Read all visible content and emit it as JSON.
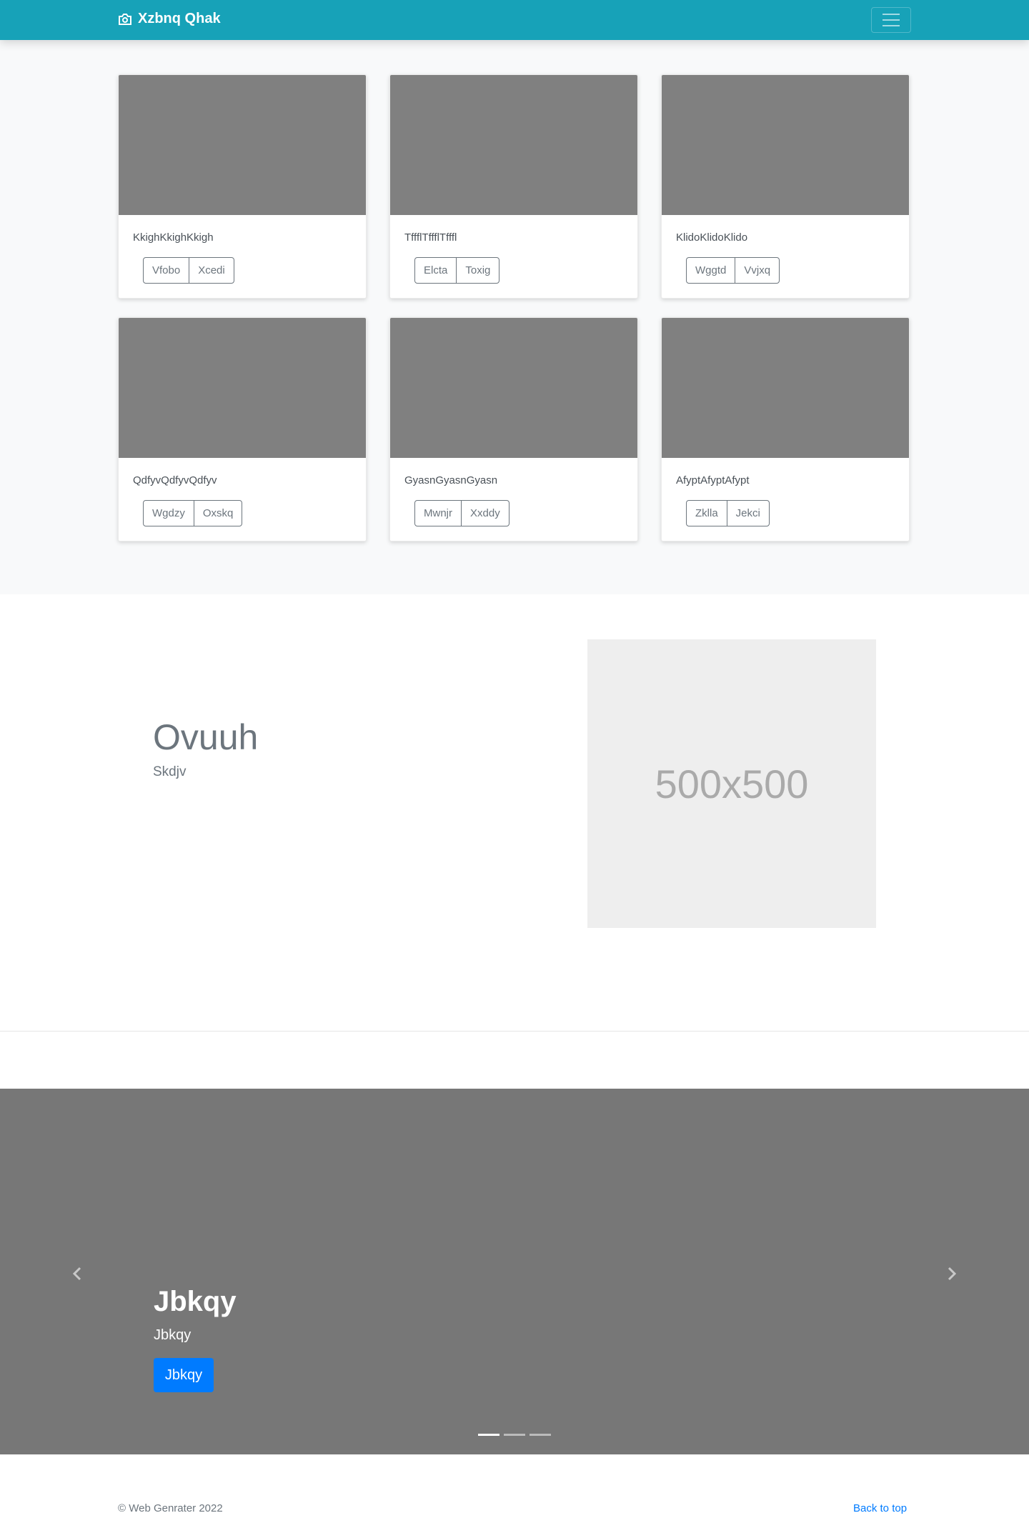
{
  "navbar": {
    "brand": "Xzbnq Qhak",
    "brand_icon": "camera-icon",
    "toggler_icon": "hamburger-icon",
    "bg_color": "#17a2b8"
  },
  "cards": [
    {
      "text": "KkighKkighKkigh",
      "buttons": [
        "Vfobo",
        "Xcedi"
      ]
    },
    {
      "text": "TffflTffflTfffl",
      "buttons": [
        "Elcta",
        "Toxig"
      ]
    },
    {
      "text": "KlidoKlidoKlido",
      "buttons": [
        "Wggtd",
        "Vvjxq"
      ]
    },
    {
      "text": "QdfyvQdfyvQdfyv",
      "buttons": [
        "Wgdzy",
        "Oxskq"
      ]
    },
    {
      "text": "GyasnGyasnGyasn",
      "buttons": [
        "Mwnjr",
        "Xxddy"
      ]
    },
    {
      "text": "AfyptAfyptAfypt",
      "buttons": [
        "Zklla",
        "Jekci"
      ]
    }
  ],
  "feature": {
    "heading": "Ovuuh",
    "subheading": "Skdjv",
    "placeholder": "500x500"
  },
  "carousel": {
    "title": "Jbkqy",
    "text": "Jbkqy",
    "button": "Jbkqy",
    "prev_icon": "chevron-left-icon",
    "next_icon": "chevron-right-icon",
    "indicator_count": 3,
    "active_indicator": 0
  },
  "footer": {
    "copyright": "© Web Genrater 2022",
    "back_to_top": "Back to top"
  }
}
